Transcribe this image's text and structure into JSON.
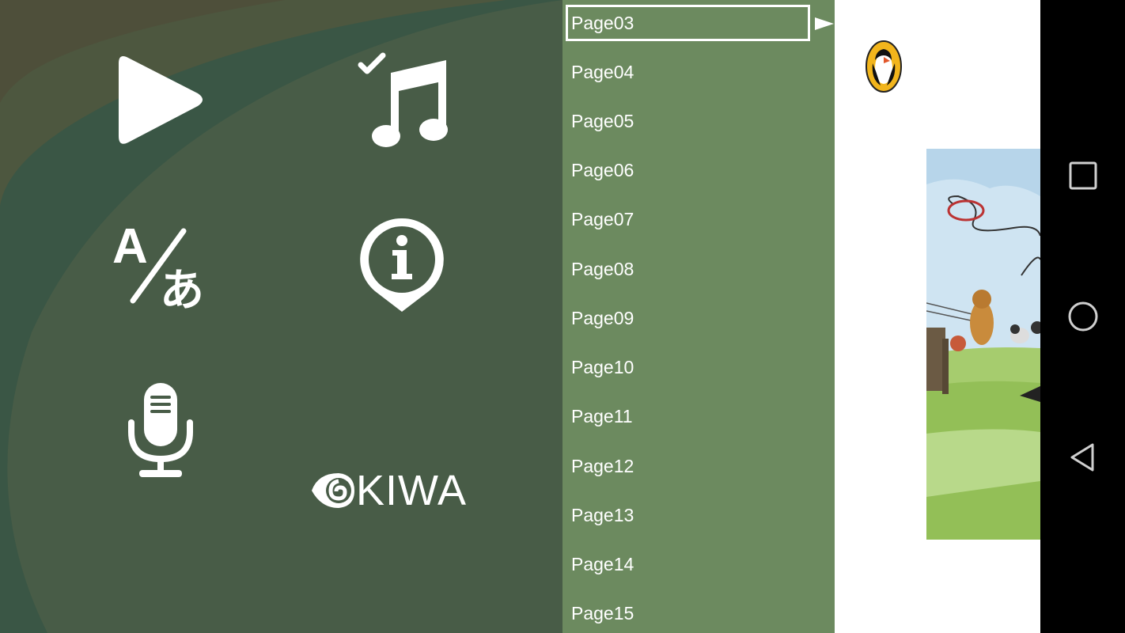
{
  "menu": {
    "icons": {
      "play": "play-icon",
      "music": "music-checked-icon",
      "language": "translate-icon",
      "info": "info-bubble-icon",
      "record": "microphone-icon"
    },
    "brand": {
      "logo_text": "KIWA"
    }
  },
  "page_list": {
    "selected_index": 0,
    "items": [
      {
        "label": "Page03"
      },
      {
        "label": "Page04"
      },
      {
        "label": "Page05"
      },
      {
        "label": "Page06"
      },
      {
        "label": "Page07"
      },
      {
        "label": "Page08"
      },
      {
        "label": "Page09"
      },
      {
        "label": "Page10"
      },
      {
        "label": "Page11"
      },
      {
        "label": "Page12"
      },
      {
        "label": "Page13"
      },
      {
        "label": "Page14"
      },
      {
        "label": "Page15"
      }
    ]
  },
  "book_preview": {
    "publisher_logo": "puffin-logo-icon"
  },
  "nav_bar": {
    "recents": "recents-square-icon",
    "home": "home-circle-icon",
    "back": "back-triangle-icon"
  },
  "colors": {
    "menu_bg": "#3a5645",
    "menu_bg_light": "#485c47",
    "list_bg": "#6c8a5f",
    "icon": "#ffffff",
    "nav_bar": "#000000"
  }
}
